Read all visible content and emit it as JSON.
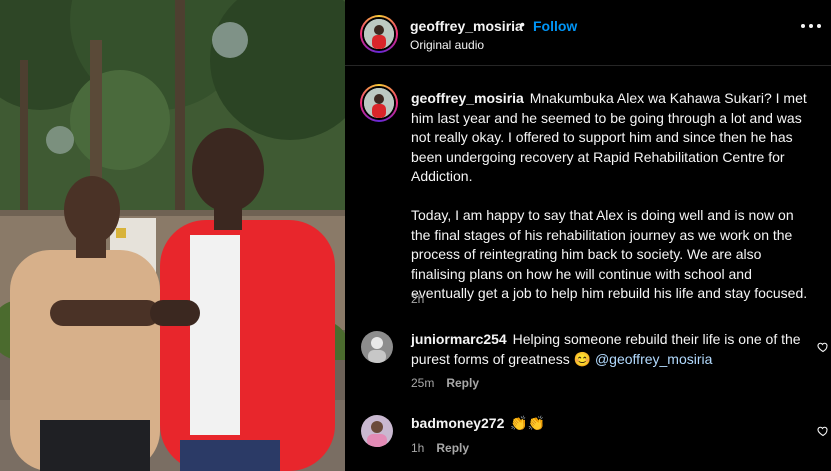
{
  "post": {
    "username": "geoffrey_mosiria",
    "separator": "•",
    "follow_label": "Follow",
    "audio_label": "Original audio",
    "more_icon": "more-horizontal-icon"
  },
  "caption": {
    "username": "geoffrey_mosiria",
    "paragraph1": "Mnakumbuka Alex wa Kahawa Sukari? I met him last year and he seemed to be going through a lot and was not really okay. I offered to support him and since then he has been undergoing recovery at Rapid Rehabilitation Centre for Addiction.",
    "paragraph2": "Today, I am happy to say that Alex is doing well and is now on the final stages of his rehabilitation journey as we work on the process of reintegrating him back to society. We are also finalising plans on how he will continue with school and eventually get a job to help him rebuild his life and stay focused.",
    "time": "2h"
  },
  "comments": [
    {
      "username": "juniormarc254",
      "text": "Helping someone rebuild their life is one of the purest forms of greatness",
      "emoji": "😊",
      "mention": "@geoffrey_mosiria",
      "time": "25m",
      "reply_label": "Reply"
    },
    {
      "username": "badmoney272",
      "text": "👏👏",
      "time": "1h",
      "reply_label": "Reply"
    }
  ],
  "colors": {
    "background": "#000000",
    "accent": "#0095f6",
    "secondary_text": "#a8a8a8",
    "jacket": "#e8262c"
  }
}
